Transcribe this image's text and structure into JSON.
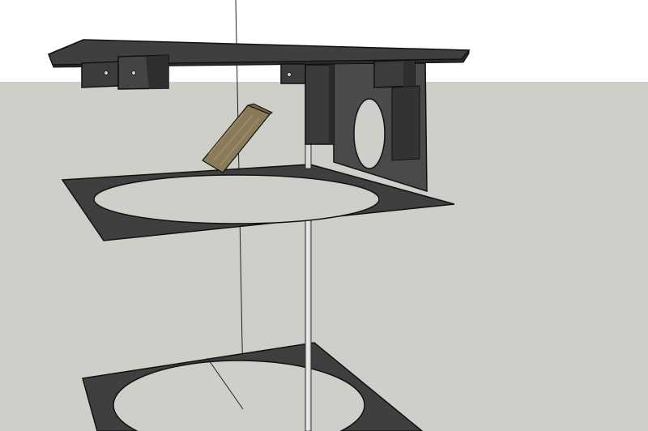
{
  "scene": {
    "sky_color": "#ffffff",
    "ground_color": "#cfcfca",
    "panel_color": "#3f3f3f",
    "panel_dark_color": "#2c2c2c",
    "edge_color": "#111111",
    "rod_color": "#d9d9d9",
    "hole_fill_color": "#cfcfca",
    "wood_color": "#8a7a5a"
  }
}
